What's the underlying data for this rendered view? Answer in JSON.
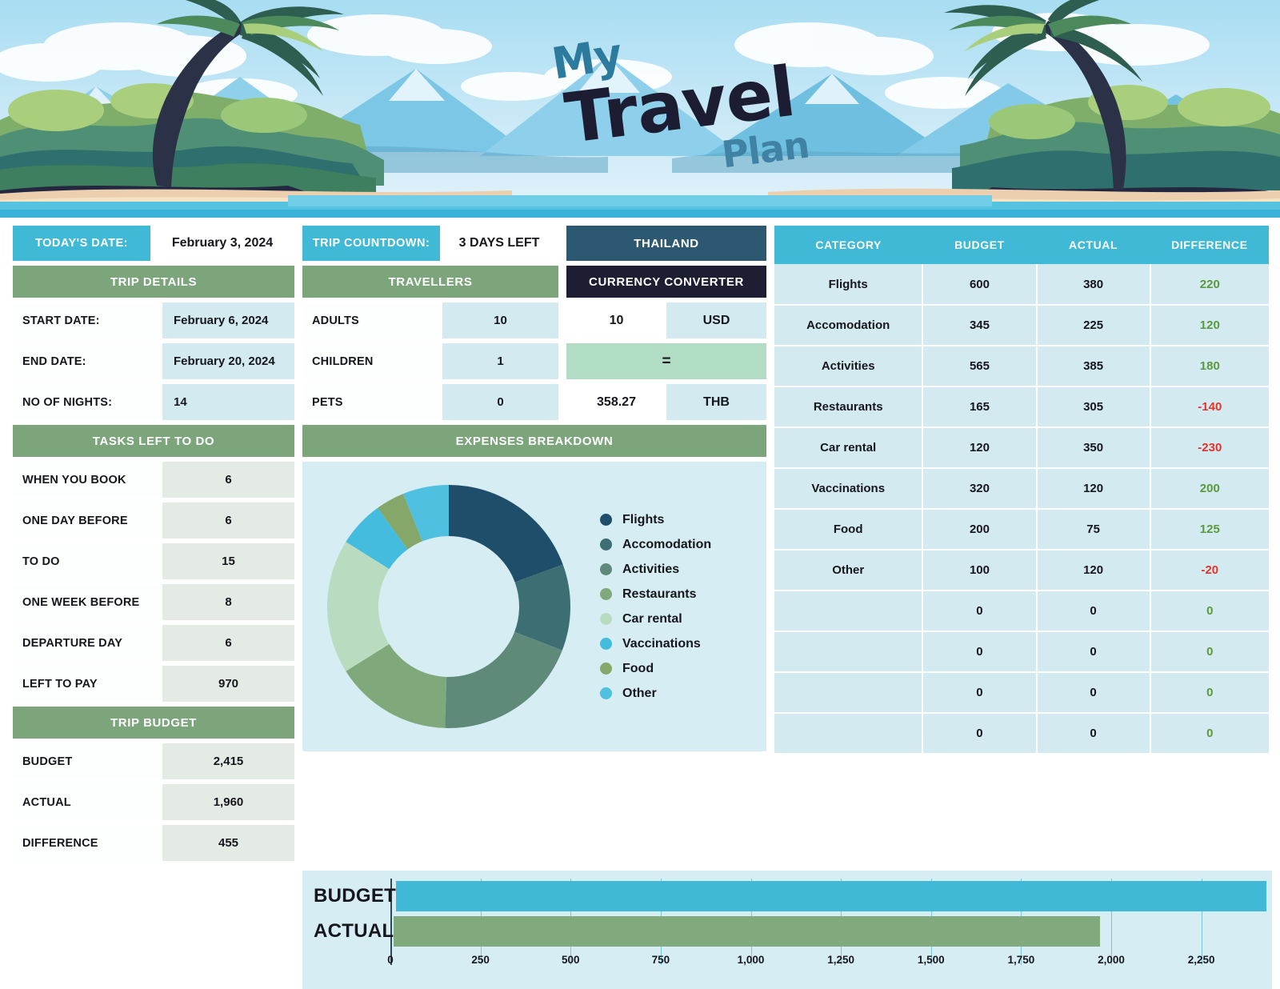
{
  "banner": {
    "title_my": "My",
    "title_travel": "Travel",
    "title_plan": "Plan"
  },
  "top": {
    "today_label": "TODAY'S DATE:",
    "today_value": "February 3, 2024",
    "countdown_label": "TRIP COUNTDOWN:",
    "countdown_value": "3 DAYS LEFT",
    "destination": "THAILAND"
  },
  "trip_details": {
    "header": "TRIP DETAILS",
    "rows": [
      {
        "label": "START DATE:",
        "value": "February 6, 2024"
      },
      {
        "label": "END DATE:",
        "value": "February 20, 2024"
      },
      {
        "label": "NO OF NIGHTS:",
        "value": "14"
      }
    ]
  },
  "travellers": {
    "header": "TRAVELLERS",
    "rows": [
      {
        "label": "ADULTS",
        "value": "10"
      },
      {
        "label": "CHILDREN",
        "value": "1"
      },
      {
        "label": "PETS",
        "value": "0"
      }
    ]
  },
  "currency": {
    "header": "CURRENCY CONVERTER",
    "from_amount": "10",
    "from_code": "USD",
    "equals": "=",
    "to_amount": "358.27",
    "to_code": "THB"
  },
  "tasks": {
    "header": "TASKS LEFT TO DO",
    "rows": [
      {
        "label": "WHEN YOU BOOK",
        "value": "6"
      },
      {
        "label": "ONE DAY BEFORE",
        "value": "6"
      },
      {
        "label": "TO DO",
        "value": "15"
      },
      {
        "label": "ONE WEEK BEFORE",
        "value": "8"
      },
      {
        "label": "DEPARTURE DAY",
        "value": "6"
      },
      {
        "label": "LEFT TO PAY",
        "value": "970"
      }
    ]
  },
  "trip_budget": {
    "header": "TRIP BUDGET",
    "rows": [
      {
        "label": "BUDGET",
        "value": "2,415"
      },
      {
        "label": "ACTUAL",
        "value": "1,960"
      },
      {
        "label": "DIFFERENCE",
        "value": "455"
      }
    ]
  },
  "expenses_panel": {
    "header": "EXPENSES BREAKDOWN"
  },
  "colors": {
    "teal": "#3fb9d6",
    "green": "#7ca57c",
    "steel": "#2c5871",
    "dark": "#1e1e32",
    "positive": "#5a9a3d",
    "negative": "#e8312a",
    "panel_bg": "#d7edf4",
    "cell_bg": "#d4eaf1"
  },
  "expense_table": {
    "columns": [
      "CATEGORY",
      "BUDGET",
      "ACTUAL",
      "DIFFERENCE"
    ],
    "rows": [
      {
        "category": "Flights",
        "budget": "600",
        "actual": "380",
        "difference": "220",
        "sign": "pos"
      },
      {
        "category": "Accomodation",
        "budget": "345",
        "actual": "225",
        "difference": "120",
        "sign": "pos"
      },
      {
        "category": "Activities",
        "budget": "565",
        "actual": "385",
        "difference": "180",
        "sign": "pos"
      },
      {
        "category": "Restaurants",
        "budget": "165",
        "actual": "305",
        "difference": "-140",
        "sign": "neg"
      },
      {
        "category": "Car rental",
        "budget": "120",
        "actual": "350",
        "difference": "-230",
        "sign": "neg"
      },
      {
        "category": "Vaccinations",
        "budget": "320",
        "actual": "120",
        "difference": "200",
        "sign": "pos"
      },
      {
        "category": "Food",
        "budget": "200",
        "actual": "75",
        "difference": "125",
        "sign": "pos"
      },
      {
        "category": "Other",
        "budget": "100",
        "actual": "120",
        "difference": "-20",
        "sign": "neg"
      },
      {
        "category": "",
        "budget": "0",
        "actual": "0",
        "difference": "0",
        "sign": "pos"
      },
      {
        "category": "",
        "budget": "0",
        "actual": "0",
        "difference": "0",
        "sign": "pos"
      },
      {
        "category": "",
        "budget": "0",
        "actual": "0",
        "difference": "0",
        "sign": "pos"
      },
      {
        "category": "",
        "budget": "0",
        "actual": "0",
        "difference": "0",
        "sign": "pos"
      }
    ]
  },
  "chart_data": [
    {
      "type": "pie",
      "title": "EXPENSES BREAKDOWN",
      "legend_position": "right",
      "categories": [
        "Flights",
        "Accomodation",
        "Activities",
        "Restaurants",
        "Car rental",
        "Vaccinations",
        "Food",
        "Other"
      ],
      "values": [
        380,
        225,
        385,
        305,
        350,
        120,
        75,
        120
      ],
      "colors": [
        "#1f4e6b",
        "#3c6e74",
        "#5f8a79",
        "#7fa97b",
        "#b9dcc0",
        "#44bcdd",
        "#85a86a",
        "#4fc0e0"
      ]
    },
    {
      "type": "bar",
      "orientation": "horizontal",
      "categories": [
        "BUDGET",
        "ACTUAL"
      ],
      "values": [
        2415,
        1960
      ],
      "colors": [
        "#3fb9d6",
        "#81a97e"
      ],
      "xlabel": "",
      "ylabel": "",
      "xlim": [
        0,
        2415
      ],
      "ticks": [
        "0",
        "250",
        "500",
        "750",
        "1,000",
        "1,250",
        "1,500",
        "1,750",
        "2,000",
        "2,250"
      ],
      "tick_values": [
        0,
        250,
        500,
        750,
        1000,
        1250,
        1500,
        1750,
        2000,
        2250
      ],
      "grid": true
    }
  ]
}
